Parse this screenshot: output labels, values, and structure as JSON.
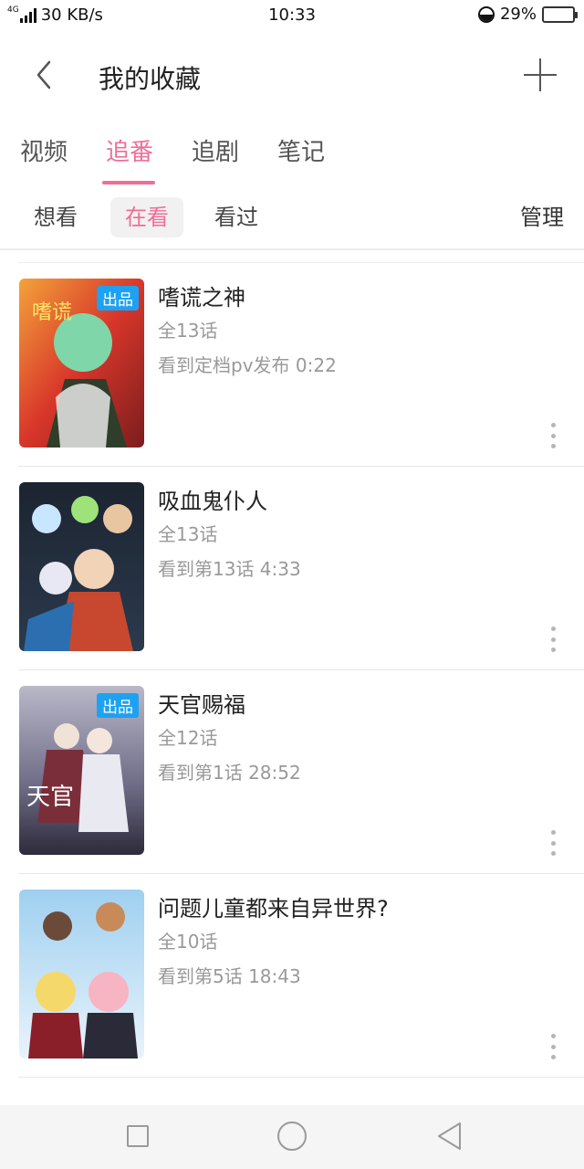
{
  "status_bar": {
    "network": "4G",
    "speed": "30 KB/s",
    "time": "10:33",
    "battery": "29%",
    "battery_level": 0.29
  },
  "header": {
    "title": "我的收藏",
    "back_icon": "chevron-left-icon",
    "add_icon": "plus-icon"
  },
  "tabs": [
    {
      "label": "视频",
      "active": false
    },
    {
      "label": "追番",
      "active": true
    },
    {
      "label": "追剧",
      "active": false
    },
    {
      "label": "笔记",
      "active": false
    }
  ],
  "filters": [
    {
      "label": "想看",
      "active": false
    },
    {
      "label": "在看",
      "active": true
    },
    {
      "label": "看过",
      "active": false
    }
  ],
  "manage_label": "管理",
  "items": [
    {
      "title": "嗜谎之神",
      "episodes": "全13话",
      "progress": "看到定档pv发布 0:22",
      "badge": "出品"
    },
    {
      "title": "吸血鬼仆人",
      "episodes": "全13话",
      "progress": "看到第13话 4:33",
      "badge": ""
    },
    {
      "title": "天官赐福",
      "episodes": "全12话",
      "progress": "看到第1话 28:52",
      "badge": "出品"
    },
    {
      "title": "问题儿童都来自异世界?",
      "episodes": "全10话",
      "progress": "看到第5话 18:43",
      "badge": ""
    }
  ],
  "colors": {
    "accent": "#ef6e96",
    "badge": "#1da1f2"
  },
  "nav_icons": [
    "recent-apps-icon",
    "home-icon",
    "back-icon"
  ]
}
